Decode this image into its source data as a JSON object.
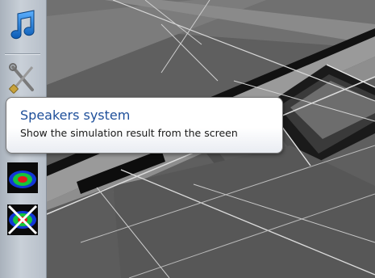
{
  "toolbar": {
    "buttons": [
      {
        "icon": "music-note-icon",
        "color": "#1a73c9"
      },
      {
        "icon": "wrench-screwdriver-icon"
      },
      {
        "icon": "speaker-simulation-icon"
      },
      {
        "icon": "speaker-simulation-disabled-icon"
      }
    ]
  },
  "tooltip": {
    "title": "Speakers system",
    "description": "Show the simulation result from the screen"
  },
  "colors": {
    "title_blue": "#1e4f9a",
    "heatmap_red": "#e41a1a",
    "heatmap_green": "#16c43a",
    "heatmap_blue": "#1238d6"
  }
}
